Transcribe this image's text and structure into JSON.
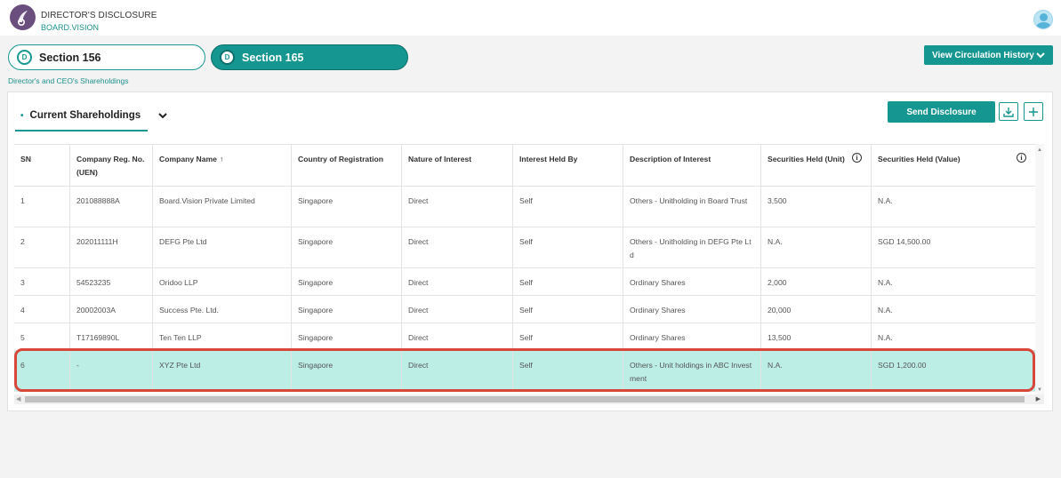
{
  "app": {
    "title": "DIRECTOR'S DISCLOSURE",
    "subtitle": "BOARD.VISION"
  },
  "section_tabs": [
    {
      "badge": "D",
      "label": "Section 156",
      "active": false
    },
    {
      "badge": "D",
      "label": "Section 165",
      "active": true
    }
  ],
  "circulation_button": "View Circulation History",
  "breadcrumb": "Director's and CEO's Shareholdings",
  "current_tab": "Current Shareholdings",
  "actions": {
    "send": "Send Disclosure"
  },
  "table": {
    "headers": [
      "SN",
      "Company Reg. No.(UEN)",
      "Company Name",
      "Country of Registration",
      "Nature of Interest",
      "Interest Held By",
      "Description of Interest",
      "Securities Held (Unit)",
      "Securities Held (Value)"
    ],
    "rows": [
      {
        "sn": "1",
        "reg": "201088888A",
        "name": "Board.Vision Private Limited",
        "country": "Singapore",
        "nature": "Direct",
        "held_by": "Self",
        "desc": "Others - Unitholding in Board Trust",
        "units": "3,500",
        "value": "N.A."
      },
      {
        "sn": "2",
        "reg": "202011111H",
        "name": "DEFG Pte Ltd",
        "country": "Singapore",
        "nature": "Direct",
        "held_by": "Self",
        "desc": "Others - Unitholding in DEFG Pte Ltd",
        "units": "N.A.",
        "value": "SGD   14,500.00"
      },
      {
        "sn": "3",
        "reg": "54523235",
        "name": "Oridoo LLP",
        "country": "Singapore",
        "nature": "Direct",
        "held_by": "Self",
        "desc": "Ordinary Shares",
        "units": "2,000",
        "value": "N.A."
      },
      {
        "sn": "4",
        "reg": "20002003A",
        "name": "Success Pte. Ltd.",
        "country": "Singapore",
        "nature": "Direct",
        "held_by": "Self",
        "desc": "Ordinary Shares",
        "units": "20,000",
        "value": "N.A."
      },
      {
        "sn": "5",
        "reg": "T17169890L",
        "name": "Ten Ten LLP",
        "country": "Singapore",
        "nature": "Direct",
        "held_by": "Self",
        "desc": "Ordinary Shares",
        "units": "13,500",
        "value": "N.A."
      },
      {
        "sn": "6",
        "reg": "-",
        "name": "XYZ Pte Ltd",
        "country": "Singapore",
        "nature": "Direct",
        "held_by": "Self",
        "desc": "Others - Unit holdings in ABC Investment",
        "units": "N.A.",
        "value": "SGD   1,200.00"
      }
    ]
  },
  "colors": {
    "accent": "#159690",
    "selected_row": "#bdeee6",
    "highlight": "#d9463a"
  }
}
